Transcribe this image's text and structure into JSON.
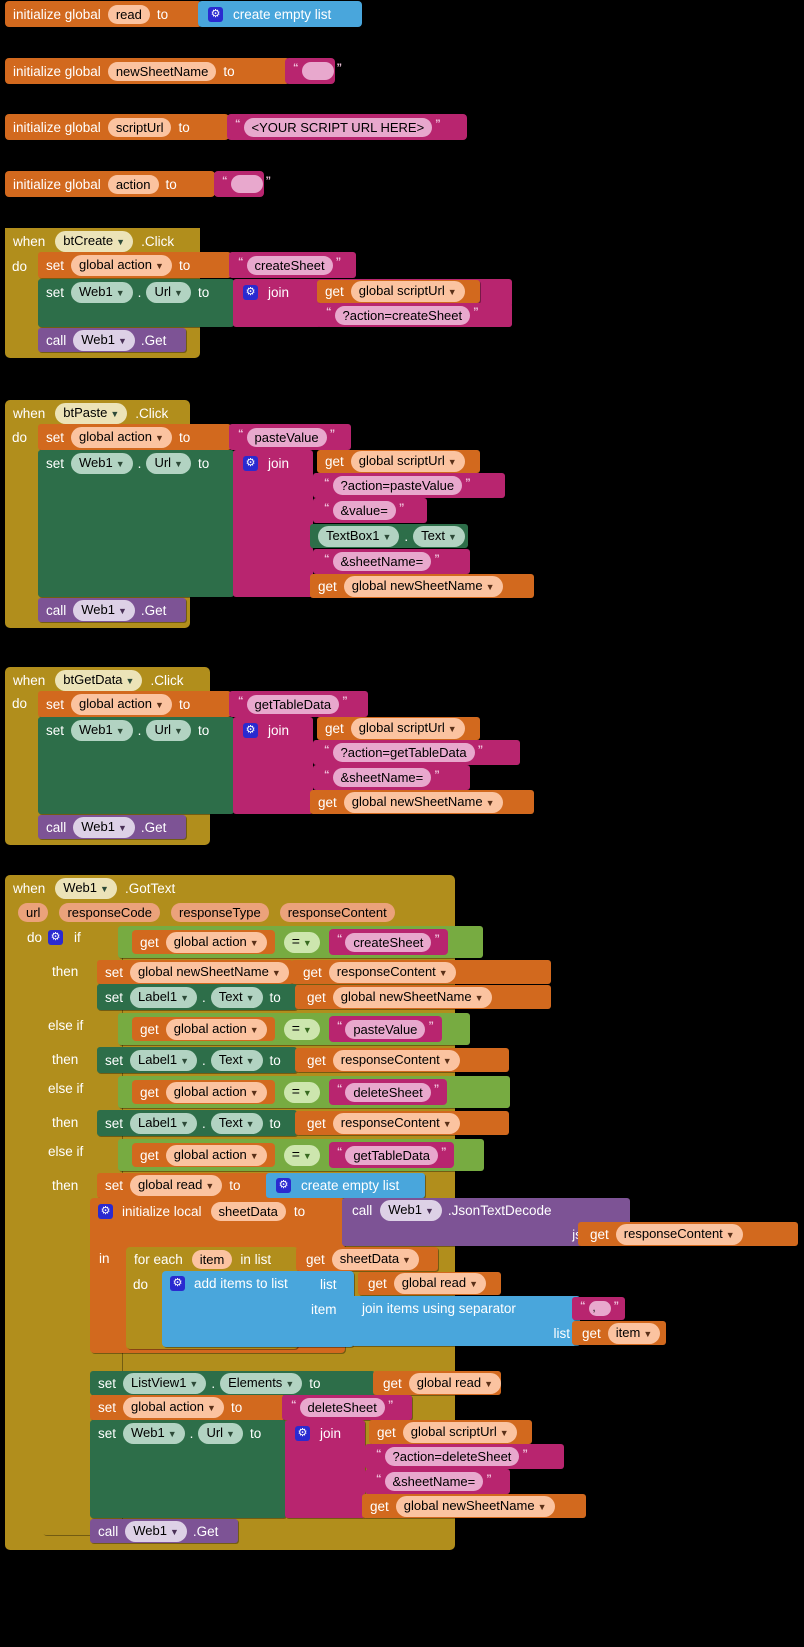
{
  "app": {
    "name": "MIT App Inventor Blocks Editor"
  },
  "globals": [
    {
      "keyword": "initialize global",
      "name": "read",
      "to": "to",
      "value_kind": "create-empty-list",
      "value": "create empty list"
    },
    {
      "keyword": "initialize global",
      "name": "newSheetName",
      "to": "to",
      "value_kind": "text",
      "value": ""
    },
    {
      "keyword": "initialize global",
      "name": "scriptUrl",
      "to": "to",
      "value_kind": "text",
      "value": "<YOUR SCRIPT URL HERE>"
    },
    {
      "keyword": "initialize global",
      "name": "action",
      "to": "to",
      "value_kind": "text",
      "value": ""
    }
  ],
  "words": {
    "when": "when",
    "do": "do",
    "then": "then",
    "else_if": "else if",
    "if": "if",
    "in": "in",
    "to": "to",
    "set": "set",
    "get": "get",
    "call": "call",
    "join": "join",
    "list": "list",
    "item": "item",
    "for_each": "for each",
    "in_list": "in list",
    "initialize_local": "initialize local",
    "url": "url",
    "create_empty_list": "create empty list",
    "add_items_to_list": "add items to list",
    "join_items_using_separator": "join items using separator",
    "equals": "=",
    "dot": ".",
    "jsonText": "jsonText",
    "comma": ","
  },
  "events": {
    "btCreate": {
      "component": "btCreate",
      "event": ".Click",
      "statements": [
        {
          "type": "set-global",
          "target": "global action",
          "to": "to",
          "value_kind": "text",
          "value": "createSheet"
        },
        {
          "type": "set-component",
          "component": "Web1",
          "property": "Url",
          "to": "to",
          "value_kind": "join",
          "join_args": [
            {
              "kind": "get",
              "label": "get",
              "value": "global scriptUrl"
            },
            {
              "kind": "text",
              "value": "?action=createSheet"
            }
          ]
        },
        {
          "type": "call",
          "label": "call",
          "component": "Web1",
          "method": ".Get"
        }
      ]
    },
    "btPaste": {
      "component": "btPaste",
      "event": ".Click",
      "statements": [
        {
          "type": "set-global",
          "target": "global action",
          "to": "to",
          "value_kind": "text",
          "value": "pasteValue"
        },
        {
          "type": "set-component",
          "component": "Web1",
          "property": "Url",
          "to": "to",
          "value_kind": "join",
          "join_args": [
            {
              "kind": "get",
              "label": "get",
              "value": "global scriptUrl"
            },
            {
              "kind": "text",
              "value": "?action=pasteValue"
            },
            {
              "kind": "text",
              "value": "&value="
            },
            {
              "kind": "component-get",
              "component": "TextBox1",
              "property": "Text"
            },
            {
              "kind": "text",
              "value": "&sheetName="
            },
            {
              "kind": "get",
              "label": "get",
              "value": "global newSheetName"
            }
          ]
        },
        {
          "type": "call",
          "label": "call",
          "component": "Web1",
          "method": ".Get"
        }
      ]
    },
    "btGetData": {
      "component": "btGetData",
      "event": ".Click",
      "statements": [
        {
          "type": "set-global",
          "target": "global action",
          "to": "to",
          "value_kind": "text",
          "value": "getTableData"
        },
        {
          "type": "set-component",
          "component": "Web1",
          "property": "Url",
          "to": "to",
          "value_kind": "join",
          "join_args": [
            {
              "kind": "get",
              "label": "get",
              "value": "global scriptUrl"
            },
            {
              "kind": "text",
              "value": "?action=getTableData"
            },
            {
              "kind": "text",
              "value": "&sheetName="
            },
            {
              "kind": "get",
              "label": "get",
              "value": "global newSheetName"
            }
          ]
        },
        {
          "type": "call",
          "label": "call",
          "component": "Web1",
          "method": ".Get"
        }
      ]
    },
    "gotText": {
      "component": "Web1",
      "event": ".GotText",
      "params": [
        "url",
        "responseCode",
        "responseType",
        "responseContent"
      ],
      "branches": [
        {
          "keyword": "if",
          "cond_get": "global action",
          "op": "=",
          "cond_text": "createSheet"
        },
        {
          "keyword": "else if",
          "cond_get": "global action",
          "op": "=",
          "cond_text": "pasteValue"
        },
        {
          "keyword": "else if",
          "cond_get": "global action",
          "op": "=",
          "cond_text": "deleteSheet"
        },
        {
          "keyword": "else if",
          "cond_get": "global action",
          "op": "=",
          "cond_text": "getTableData"
        }
      ],
      "then1": [
        {
          "type": "set-global",
          "target": "global newSheetName",
          "to": "to",
          "value_kind": "get",
          "value": "responseContent"
        },
        {
          "type": "set-component",
          "component": "Label1",
          "property": "Text",
          "to": "to",
          "value_kind": "get",
          "value": "global newSheetName"
        }
      ],
      "then2": [
        {
          "type": "set-component",
          "component": "Label1",
          "property": "Text",
          "to": "to",
          "value_kind": "get",
          "value": "responseContent"
        }
      ],
      "then3": [
        {
          "type": "set-component",
          "component": "Label1",
          "property": "Text",
          "to": "to",
          "value_kind": "get",
          "value": "responseContent"
        }
      ],
      "then4": {
        "set_read": {
          "target": "global read",
          "to": "to",
          "value": "create empty list"
        },
        "local": {
          "keyword": "initialize local",
          "name": "sheetData",
          "to": "to",
          "call_label": "call",
          "call_component": "Web1",
          "call_method": ".JsonTextDecode",
          "arg_label": "jsonText",
          "arg_get": "responseContent"
        },
        "loop": {
          "for_each": "for each",
          "var": "item",
          "in_list": "in list",
          "list_get": "sheetData",
          "do_label": "do",
          "add": {
            "label": "add items to list",
            "list_label": "list",
            "list_get": "global read",
            "item_label": "item",
            "joiner_label": "join items using separator",
            "separator": ",",
            "inner_list_label": "list",
            "inner_list_get": "item"
          }
        },
        "tail": [
          {
            "type": "set-component",
            "component": "ListView1",
            "property": "Elements",
            "to": "to",
            "value_kind": "get",
            "value": "global read"
          },
          {
            "type": "set-global",
            "target": "global action",
            "to": "to",
            "value_kind": "text",
            "value": "deleteSheet"
          },
          {
            "type": "set-component",
            "component": "Web1",
            "property": "Url",
            "to": "to",
            "value_kind": "join",
            "join_args": [
              {
                "kind": "get",
                "label": "get",
                "value": "global scriptUrl"
              },
              {
                "kind": "text",
                "value": "?action=deleteSheet"
              },
              {
                "kind": "text",
                "value": "&sheetName="
              },
              {
                "kind": "get",
                "label": "get",
                "value": "global newSheetName"
              }
            ]
          },
          {
            "type": "call",
            "label": "call",
            "component": "Web1",
            "method": ".Get"
          }
        ]
      }
    }
  },
  "colors": {
    "variable": "#d2691e",
    "list": "#49a6dc",
    "text": "#b8256f",
    "control": "#b18e1c",
    "logic": "#77ab41",
    "component_set": "#2d6e49",
    "method_call": "#7d5395",
    "background": "#000000"
  }
}
